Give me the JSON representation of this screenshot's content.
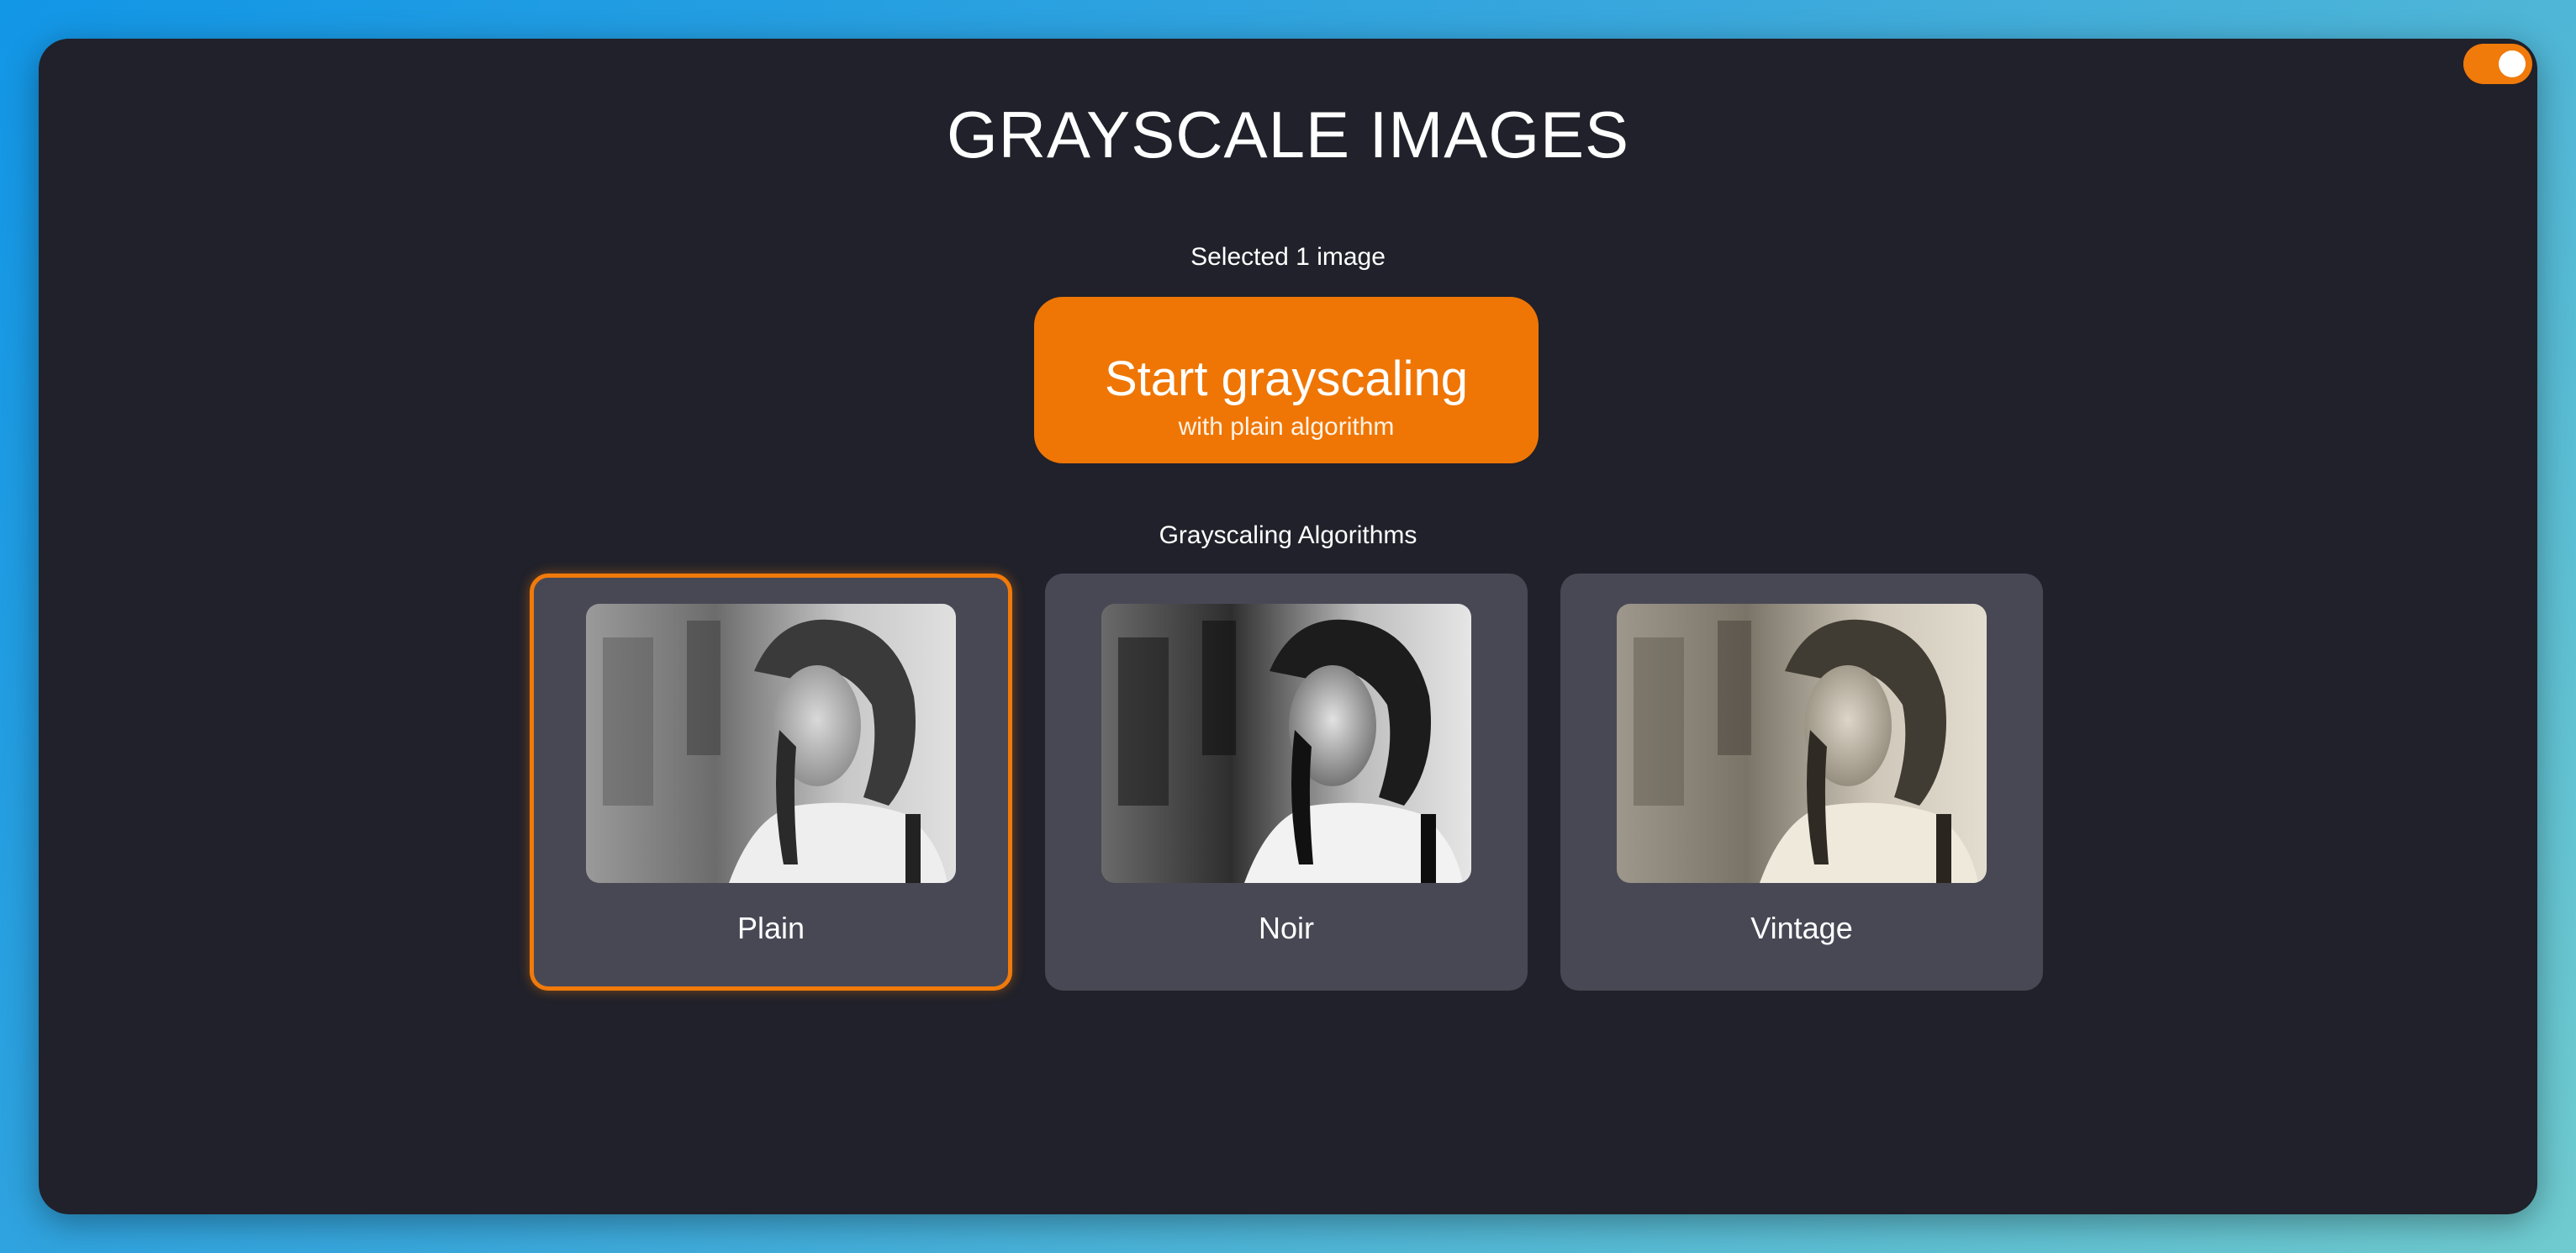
{
  "header": {
    "title": "GRAYSCALE IMAGES",
    "theme_toggle": {
      "state": "on",
      "icon": "toggle-icon"
    }
  },
  "selection": {
    "status": "Selected 1 image"
  },
  "start_button": {
    "label": "Start grayscaling",
    "sublabel": "with plain algorithm"
  },
  "algorithms": {
    "heading": "Grayscaling Algorithms",
    "selected": "Plain",
    "items": [
      {
        "label": "Plain"
      },
      {
        "label": "Noir"
      },
      {
        "label": "Vintage"
      }
    ]
  },
  "colors": {
    "accent": "#ef7605",
    "window_bg": "#20212a",
    "card_bg": "#484855"
  }
}
